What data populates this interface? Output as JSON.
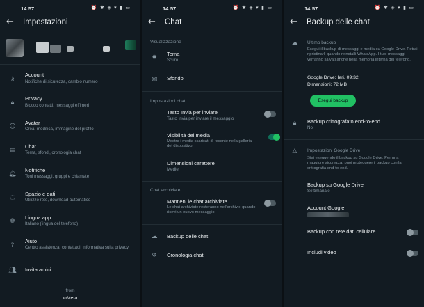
{
  "status": {
    "time": "14:57",
    "icons": "⏰ ✱ ◈ ▾ ▮ ▭"
  },
  "settings": {
    "title": "Impostazioni",
    "items": [
      {
        "title": "Account",
        "sub": "Notifiche di sicurezza, cambio numero",
        "icon": "key-icon"
      },
      {
        "title": "Privacy",
        "sub": "Blocco contatti, messaggi effimeri",
        "icon": "lock-icon"
      },
      {
        "title": "Avatar",
        "sub": "Crea, modifica, immagine del profilo",
        "icon": "avatar-icon"
      },
      {
        "title": "Chat",
        "sub": "Tema, sfondi, cronologia chat",
        "icon": "chat-icon"
      },
      {
        "title": "Notifiche",
        "sub": "Toni messaggi, gruppi e chiamate",
        "icon": "bell-icon"
      },
      {
        "title": "Spazio e dati",
        "sub": "Utilizzo rete, download automatico",
        "icon": "data-icon"
      },
      {
        "title": "Lingua app",
        "sub": "Italiano (lingua del telefono)",
        "icon": "globe-icon"
      },
      {
        "title": "Aiuto",
        "sub": "Centro assistenza, contattaci, informativa sulla privacy",
        "icon": "help-icon"
      },
      {
        "title": "Invita amici",
        "sub": "",
        "icon": "people-icon"
      }
    ],
    "from": "from",
    "meta": "∞Meta"
  },
  "chat": {
    "title": "Chat",
    "section_display": "Visualizzazione",
    "tema": {
      "title": "Tema",
      "sub": "Scuro"
    },
    "sfondo": "Sfondo",
    "section_settings": "Impostazioni chat",
    "invio": {
      "title": "Tasto Invia per inviare",
      "sub": "Tasto Invia per inviare il messaggio"
    },
    "media": {
      "title": "Visibilità dei media",
      "sub": "Mostra i media scaricati di recente nella galleria del dispositivo."
    },
    "font": {
      "title": "Dimensioni carattere",
      "sub": "Medie"
    },
    "section_archived": "Chat archiviate",
    "archived": {
      "title": "Mantieni le chat archiviate",
      "sub": "Le chat archiviate resteranno nell'archivio quando ricevi un nuovo messaggio."
    },
    "backup": "Backup delle chat",
    "history": "Cronologia chat"
  },
  "backup": {
    "title": "Backup delle chat",
    "last_backup": "Ultimo backup",
    "desc": "Esegui il backup di messaggi e media su Google Drive. Potrai ripristinarli quando reinstalli WhatsApp. I tuoi messaggi verranno salvati anche nella memoria interna del telefono.",
    "drive_line": "Google Drive: Ieri, 09:32",
    "size_line": "Dimensioni: 72 MB",
    "button": "Esegui backup",
    "encrypted": {
      "title": "Backup crittografato end-to-end",
      "sub": "No"
    },
    "drive_section": "Impostazioni Google Drive",
    "drive_desc": "Stai eseguendo il backup su Google Drive. Per una maggiore sicurezza, puoi proteggere il backup con la crittografia end-to-end.",
    "frequency": {
      "title": "Backup su Google Drive",
      "sub": "Settimanale"
    },
    "account": "Account Google",
    "cellular": "Backup con rete dati cellulare",
    "videos": "Includi video"
  },
  "toggles": {
    "invio": false,
    "media": true,
    "archived": false,
    "cellular": false,
    "videos": false
  },
  "colors": {
    "accent": "#21c063",
    "background": "#121b22",
    "secondary_text": "#8696a0"
  }
}
